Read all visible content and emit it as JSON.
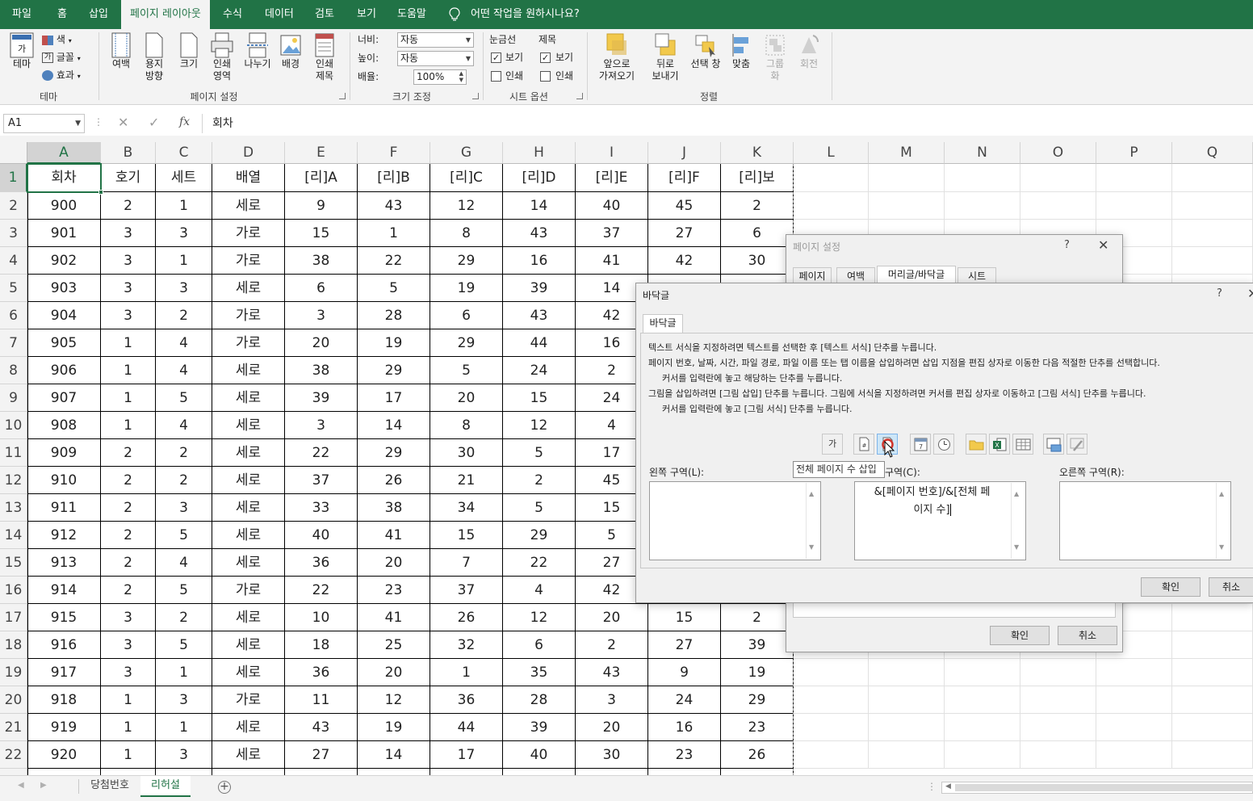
{
  "menu": {
    "tabs": [
      "파일",
      "홈",
      "삽입",
      "페이지 레이아웃",
      "수식",
      "데이터",
      "검토",
      "보기",
      "도움말"
    ],
    "active_tab": "페이지 레이아웃",
    "tell_me": "어떤 작업을 원하시나요?"
  },
  "ribbon": {
    "theme": {
      "theme_label": "테마",
      "colors_label": "색",
      "fonts_label": "글꼴",
      "effects_label": "효과",
      "group_label": "테마"
    },
    "page_setup": {
      "margins": "여백",
      "orientation_1": "용지",
      "orientation_2": "방향",
      "size": "크기",
      "print_area_1": "인쇄",
      "print_area_2": "영역",
      "breaks": "나누기",
      "background": "배경",
      "print_titles_1": "인쇄",
      "print_titles_2": "제목",
      "group_label": "페이지 설정"
    },
    "scale": {
      "width_label": "너비:",
      "width_value": "자동",
      "height_label": "높이:",
      "height_value": "자동",
      "scale_label": "배율:",
      "scale_value": "100%",
      "group_label": "크기 조정"
    },
    "sheet_options": {
      "gridlines": "눈금선",
      "headings": "제목",
      "view": "보기",
      "print": "인쇄",
      "group_label": "시트 옵션"
    },
    "arrange": {
      "bring_forward_1": "앞으로",
      "bring_forward_2": "가져오기",
      "send_backward_1": "뒤로",
      "send_backward_2": "보내기",
      "selection_pane": "선택 창",
      "align": "맞춤",
      "group_1": "그룹",
      "group_2": "화",
      "rotate": "회전",
      "group_label": "정렬"
    }
  },
  "formula_bar": {
    "name_box": "A1",
    "fx": "fx",
    "content": "회차"
  },
  "sheet": {
    "columns": [
      "A",
      "B",
      "C",
      "D",
      "E",
      "F",
      "G",
      "H",
      "I",
      "J",
      "K",
      "L",
      "M",
      "N",
      "O",
      "P",
      "Q"
    ],
    "row_numbers": [
      "1",
      "2",
      "3",
      "4",
      "5",
      "6",
      "7",
      "8",
      "9",
      "10",
      "11",
      "12",
      "13",
      "14",
      "15",
      "16",
      "17",
      "18",
      "19",
      "20",
      "21",
      "22"
    ],
    "rows": [
      [
        "회차",
        "호기",
        "세트",
        "배열",
        "[리]A",
        "[리]B",
        "[리]C",
        "[리]D",
        "[리]E",
        "[리]F",
        "[리]보"
      ],
      [
        "900",
        "2",
        "1",
        "세로",
        "9",
        "43",
        "12",
        "14",
        "40",
        "45",
        "2"
      ],
      [
        "901",
        "3",
        "3",
        "가로",
        "15",
        "1",
        "8",
        "43",
        "37",
        "27",
        "6"
      ],
      [
        "902",
        "3",
        "1",
        "가로",
        "38",
        "22",
        "29",
        "16",
        "41",
        "42",
        "30"
      ],
      [
        "903",
        "3",
        "3",
        "세로",
        "6",
        "5",
        "19",
        "39",
        "14",
        "",
        ""
      ],
      [
        "904",
        "3",
        "2",
        "가로",
        "3",
        "28",
        "6",
        "43",
        "42",
        "",
        ""
      ],
      [
        "905",
        "1",
        "4",
        "가로",
        "20",
        "19",
        "29",
        "44",
        "16",
        "",
        ""
      ],
      [
        "906",
        "1",
        "4",
        "세로",
        "38",
        "29",
        "5",
        "24",
        "2",
        "",
        ""
      ],
      [
        "907",
        "1",
        "5",
        "세로",
        "39",
        "17",
        "20",
        "15",
        "24",
        "",
        ""
      ],
      [
        "908",
        "1",
        "4",
        "세로",
        "3",
        "14",
        "8",
        "12",
        "4",
        "",
        ""
      ],
      [
        "909",
        "2",
        "2",
        "세로",
        "22",
        "29",
        "30",
        "5",
        "17",
        "",
        ""
      ],
      [
        "910",
        "2",
        "2",
        "세로",
        "37",
        "26",
        "21",
        "2",
        "45",
        "",
        ""
      ],
      [
        "911",
        "2",
        "3",
        "세로",
        "33",
        "38",
        "34",
        "5",
        "15",
        "",
        ""
      ],
      [
        "912",
        "2",
        "5",
        "세로",
        "40",
        "41",
        "15",
        "29",
        "5",
        "",
        ""
      ],
      [
        "913",
        "2",
        "4",
        "세로",
        "36",
        "20",
        "7",
        "22",
        "27",
        "",
        ""
      ],
      [
        "914",
        "2",
        "5",
        "가로",
        "22",
        "23",
        "37",
        "4",
        "42",
        "",
        ""
      ],
      [
        "915",
        "3",
        "2",
        "세로",
        "10",
        "41",
        "26",
        "12",
        "20",
        "15",
        "2"
      ],
      [
        "916",
        "3",
        "5",
        "세로",
        "18",
        "25",
        "32",
        "6",
        "2",
        "27",
        "39"
      ],
      [
        "917",
        "3",
        "1",
        "세로",
        "36",
        "20",
        "1",
        "35",
        "43",
        "9",
        "19"
      ],
      [
        "918",
        "1",
        "3",
        "가로",
        "11",
        "12",
        "36",
        "28",
        "3",
        "24",
        "29"
      ],
      [
        "919",
        "1",
        "1",
        "세로",
        "43",
        "19",
        "44",
        "39",
        "20",
        "16",
        "23"
      ],
      [
        "920",
        "1",
        "3",
        "세로",
        "27",
        "14",
        "17",
        "40",
        "30",
        "23",
        "26"
      ]
    ]
  },
  "sheet_tabs": {
    "tabs": [
      "당첨번호",
      "리허설"
    ],
    "active": "리허설"
  },
  "page_setup_dialog": {
    "title": "페이지 설정",
    "help": "?",
    "tabs": [
      "페이지",
      "여백",
      "머리글/바닥글",
      "시트"
    ],
    "active_tab": "머리글/바닥글",
    "ok": "확인",
    "cancel": "취소"
  },
  "footer_dialog": {
    "title": "바닥글",
    "help": "?",
    "tab": "바닥글",
    "instructions": [
      "텍스트 서식을 지정하려면 텍스트를 선택한 후 [텍스트 서식] 단추를 누릅니다.",
      "페이지 번호, 날짜, 시간, 파일 경로, 파일 이름 또는 탭 이름을 삽입하려면 삽입 지점을 편집 상자로 이동한 다음 적절한 단추를 선택합니다.",
      "커서를 입력란에 놓고 해당하는 단추를 누릅니다.",
      "그림을 삽입하려면 [그림 삽입] 단추를 누릅니다.  그림에 서식을 지정하려면 커서를 편집 상자로 이동하고 [그림 서식] 단추를 누릅니다.",
      "커서를 입력란에 놓고 [그림 서식] 단추를 누릅니다."
    ],
    "format_text_glyph": "가",
    "left_section_label": "왼쪽 구역(L):",
    "center_section_label": "구역(C):",
    "right_section_label": "오른쪽 구역(R):",
    "center_line_1": "&[페이지 번호]/&[전체 페",
    "center_line_2": "이지 수]",
    "tooltip": "전체 페이지 수 삽입",
    "ok": "확인",
    "cancel": "취소"
  },
  "colors": {
    "accent": "#217346",
    "ribbon_bg": "#f3f3f3",
    "dialog_bg": "#f0f0f0"
  }
}
